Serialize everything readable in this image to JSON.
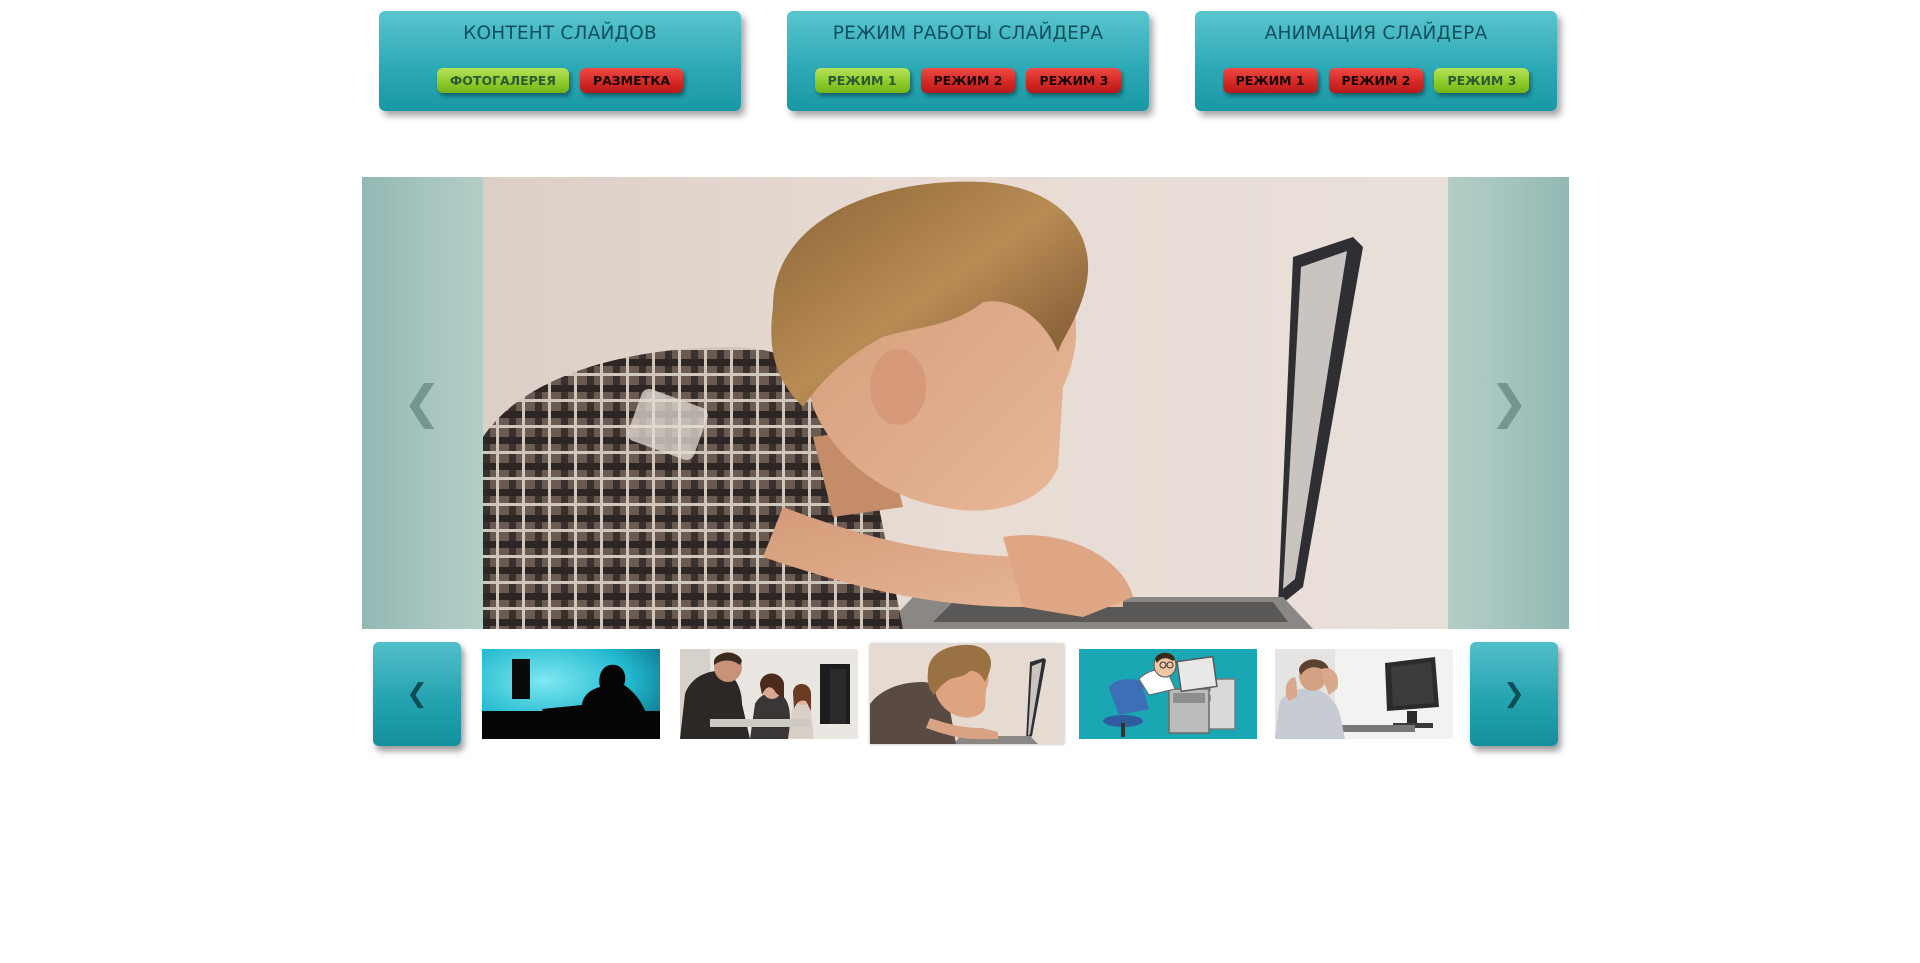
{
  "panels": [
    {
      "title": "КОНТЕНТ СЛАЙДОВ",
      "buttons": [
        {
          "label": "ФОТОГАЛЕРЕЯ",
          "state": "active"
        },
        {
          "label": "РАЗМЕТКА",
          "state": "inactive"
        }
      ]
    },
    {
      "title": "РЕЖИМ РАБОТЫ СЛАЙДЕРА",
      "buttons": [
        {
          "label": "РЕЖИМ 1",
          "state": "active"
        },
        {
          "label": "РЕЖИМ 2",
          "state": "inactive"
        },
        {
          "label": "РЕЖИМ 3",
          "state": "inactive"
        }
      ]
    },
    {
      "title": "АНИМАЦИЯ СЛАЙДЕРА",
      "buttons": [
        {
          "label": "РЕЖИМ 1",
          "state": "inactive"
        },
        {
          "label": "РЕЖИМ 2",
          "state": "inactive"
        },
        {
          "label": "РЕЖИМ 3",
          "state": "active"
        }
      ]
    }
  ],
  "slider": {
    "prev_glyph": "❮",
    "next_glyph": "❯",
    "current_slide": 3
  },
  "thumbnails": {
    "prev_glyph": "❮",
    "next_glyph": "❯",
    "items": [
      {
        "icon": "silhouette-at-computer-photo",
        "active": false
      },
      {
        "icon": "students-computer-class-photo",
        "active": false
      },
      {
        "icon": "boy-typing-laptop-photo",
        "active": true
      },
      {
        "icon": "cartoon-man-computer-illustration",
        "active": false
      },
      {
        "icon": "stressed-man-monitor-photo",
        "active": false
      }
    ]
  },
  "colors": {
    "panel_teal": "#2eaab6",
    "panel_title": "#10505a",
    "button_active": "#8fcc2b",
    "button_inactive": "#d52a25"
  }
}
